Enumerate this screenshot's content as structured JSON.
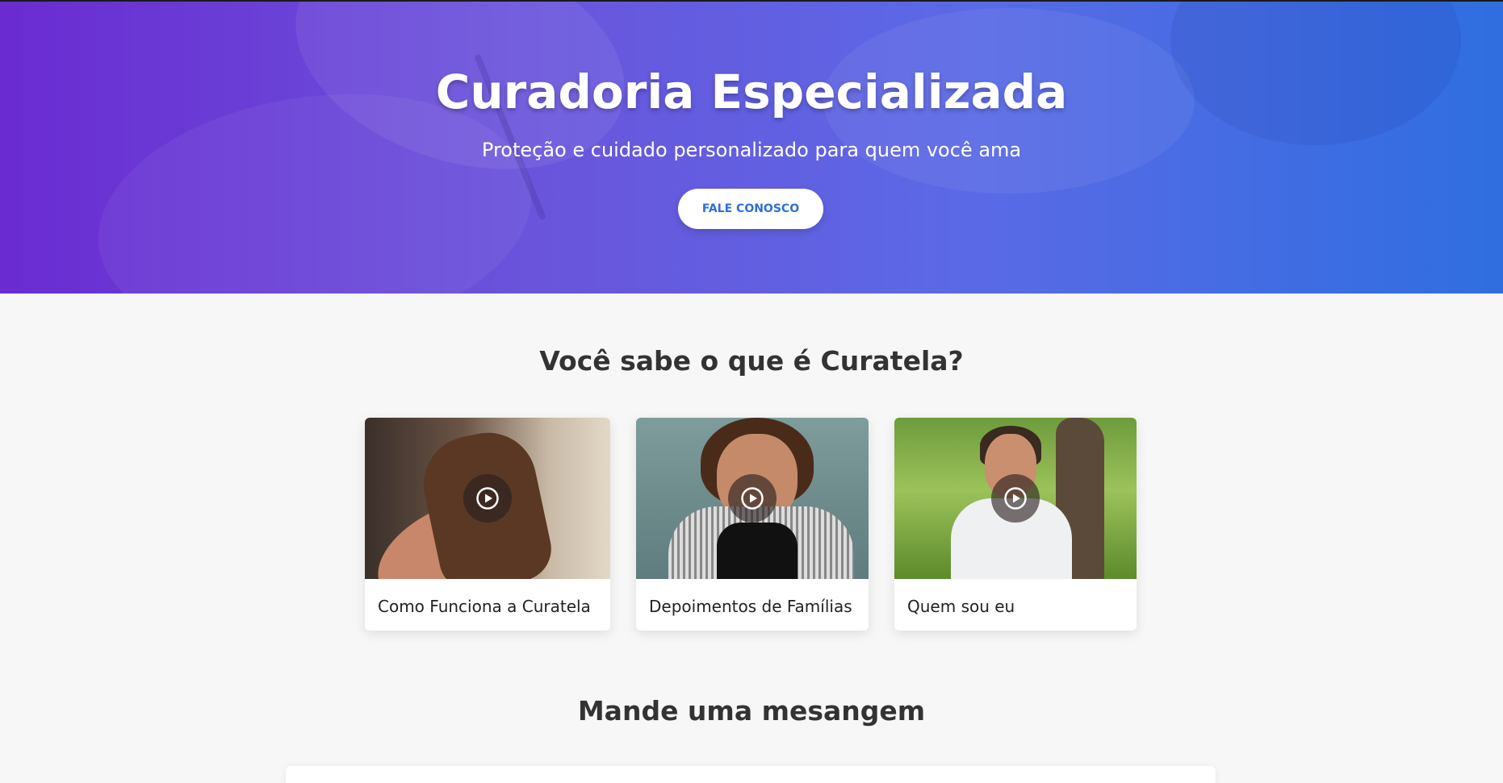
{
  "hero": {
    "title": "Curadoria Especializada",
    "subtitle": "Proteção e cuidado personalizado para quem você ama",
    "cta_label": "FALE CONOSCO"
  },
  "videos_section": {
    "title": "Você sabe o que é Curatela?",
    "cards": [
      {
        "label": "Como Funciona a Curatela",
        "icon": "play-icon"
      },
      {
        "label": "Depoimentos de Famílias",
        "icon": "play-icon"
      },
      {
        "label": "Quem sou eu",
        "icon": "play-icon"
      }
    ]
  },
  "message_section": {
    "title": "Mande uma mesangem"
  },
  "colors": {
    "hero_gradient_start": "#6a2bd1",
    "hero_gradient_end": "#2f6ee0",
    "accent": "#2f6ee0",
    "background": "#f7f7f7"
  }
}
